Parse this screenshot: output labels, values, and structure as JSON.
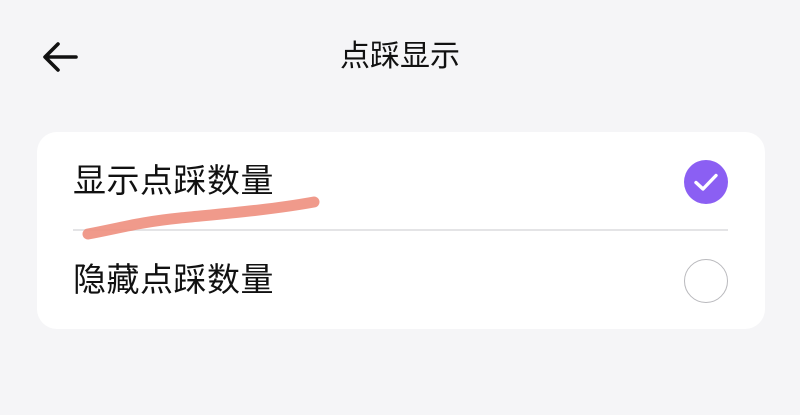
{
  "header": {
    "title": "点踩显示",
    "back_icon": "arrow-left-icon"
  },
  "options": [
    {
      "label": "显示点踩数量",
      "selected": true
    },
    {
      "label": "隐藏点踩数量",
      "selected": false
    }
  ],
  "colors": {
    "accent": "#8b5ff3",
    "annotation_stroke": "#ee8f7e",
    "background": "#f5f5f7",
    "card": "#ffffff"
  }
}
